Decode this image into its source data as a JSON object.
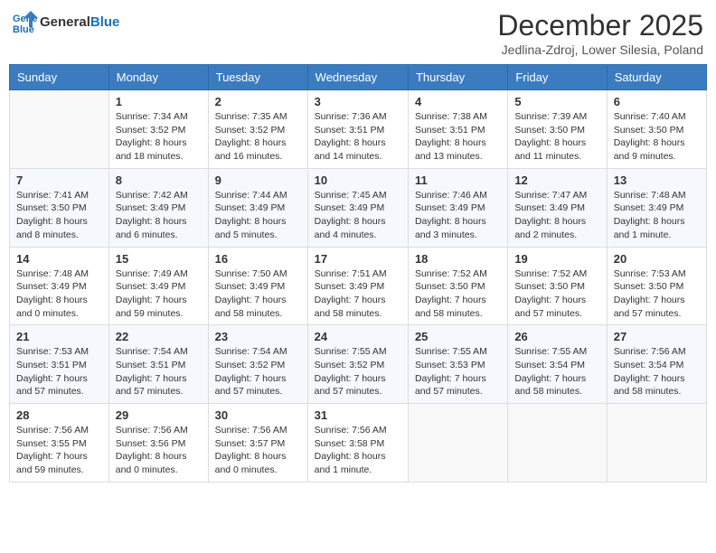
{
  "header": {
    "logo_line1": "General",
    "logo_line2": "Blue",
    "month": "December 2025",
    "location": "Jedlina-Zdroj, Lower Silesia, Poland"
  },
  "weekdays": [
    "Sunday",
    "Monday",
    "Tuesday",
    "Wednesday",
    "Thursday",
    "Friday",
    "Saturday"
  ],
  "weeks": [
    [
      {
        "day": "",
        "sunrise": "",
        "sunset": "",
        "daylight": ""
      },
      {
        "day": "1",
        "sunrise": "Sunrise: 7:34 AM",
        "sunset": "Sunset: 3:52 PM",
        "daylight": "Daylight: 8 hours and 18 minutes."
      },
      {
        "day": "2",
        "sunrise": "Sunrise: 7:35 AM",
        "sunset": "Sunset: 3:52 PM",
        "daylight": "Daylight: 8 hours and 16 minutes."
      },
      {
        "day": "3",
        "sunrise": "Sunrise: 7:36 AM",
        "sunset": "Sunset: 3:51 PM",
        "daylight": "Daylight: 8 hours and 14 minutes."
      },
      {
        "day": "4",
        "sunrise": "Sunrise: 7:38 AM",
        "sunset": "Sunset: 3:51 PM",
        "daylight": "Daylight: 8 hours and 13 minutes."
      },
      {
        "day": "5",
        "sunrise": "Sunrise: 7:39 AM",
        "sunset": "Sunset: 3:50 PM",
        "daylight": "Daylight: 8 hours and 11 minutes."
      },
      {
        "day": "6",
        "sunrise": "Sunrise: 7:40 AM",
        "sunset": "Sunset: 3:50 PM",
        "daylight": "Daylight: 8 hours and 9 minutes."
      }
    ],
    [
      {
        "day": "7",
        "sunrise": "Sunrise: 7:41 AM",
        "sunset": "Sunset: 3:50 PM",
        "daylight": "Daylight: 8 hours and 8 minutes."
      },
      {
        "day": "8",
        "sunrise": "Sunrise: 7:42 AM",
        "sunset": "Sunset: 3:49 PM",
        "daylight": "Daylight: 8 hours and 6 minutes."
      },
      {
        "day": "9",
        "sunrise": "Sunrise: 7:44 AM",
        "sunset": "Sunset: 3:49 PM",
        "daylight": "Daylight: 8 hours and 5 minutes."
      },
      {
        "day": "10",
        "sunrise": "Sunrise: 7:45 AM",
        "sunset": "Sunset: 3:49 PM",
        "daylight": "Daylight: 8 hours and 4 minutes."
      },
      {
        "day": "11",
        "sunrise": "Sunrise: 7:46 AM",
        "sunset": "Sunset: 3:49 PM",
        "daylight": "Daylight: 8 hours and 3 minutes."
      },
      {
        "day": "12",
        "sunrise": "Sunrise: 7:47 AM",
        "sunset": "Sunset: 3:49 PM",
        "daylight": "Daylight: 8 hours and 2 minutes."
      },
      {
        "day": "13",
        "sunrise": "Sunrise: 7:48 AM",
        "sunset": "Sunset: 3:49 PM",
        "daylight": "Daylight: 8 hours and 1 minute."
      }
    ],
    [
      {
        "day": "14",
        "sunrise": "Sunrise: 7:48 AM",
        "sunset": "Sunset: 3:49 PM",
        "daylight": "Daylight: 8 hours and 0 minutes."
      },
      {
        "day": "15",
        "sunrise": "Sunrise: 7:49 AM",
        "sunset": "Sunset: 3:49 PM",
        "daylight": "Daylight: 7 hours and 59 minutes."
      },
      {
        "day": "16",
        "sunrise": "Sunrise: 7:50 AM",
        "sunset": "Sunset: 3:49 PM",
        "daylight": "Daylight: 7 hours and 58 minutes."
      },
      {
        "day": "17",
        "sunrise": "Sunrise: 7:51 AM",
        "sunset": "Sunset: 3:49 PM",
        "daylight": "Daylight: 7 hours and 58 minutes."
      },
      {
        "day": "18",
        "sunrise": "Sunrise: 7:52 AM",
        "sunset": "Sunset: 3:50 PM",
        "daylight": "Daylight: 7 hours and 58 minutes."
      },
      {
        "day": "19",
        "sunrise": "Sunrise: 7:52 AM",
        "sunset": "Sunset: 3:50 PM",
        "daylight": "Daylight: 7 hours and 57 minutes."
      },
      {
        "day": "20",
        "sunrise": "Sunrise: 7:53 AM",
        "sunset": "Sunset: 3:50 PM",
        "daylight": "Daylight: 7 hours and 57 minutes."
      }
    ],
    [
      {
        "day": "21",
        "sunrise": "Sunrise: 7:53 AM",
        "sunset": "Sunset: 3:51 PM",
        "daylight": "Daylight: 7 hours and 57 minutes."
      },
      {
        "day": "22",
        "sunrise": "Sunrise: 7:54 AM",
        "sunset": "Sunset: 3:51 PM",
        "daylight": "Daylight: 7 hours and 57 minutes."
      },
      {
        "day": "23",
        "sunrise": "Sunrise: 7:54 AM",
        "sunset": "Sunset: 3:52 PM",
        "daylight": "Daylight: 7 hours and 57 minutes."
      },
      {
        "day": "24",
        "sunrise": "Sunrise: 7:55 AM",
        "sunset": "Sunset: 3:52 PM",
        "daylight": "Daylight: 7 hours and 57 minutes."
      },
      {
        "day": "25",
        "sunrise": "Sunrise: 7:55 AM",
        "sunset": "Sunset: 3:53 PM",
        "daylight": "Daylight: 7 hours and 57 minutes."
      },
      {
        "day": "26",
        "sunrise": "Sunrise: 7:55 AM",
        "sunset": "Sunset: 3:54 PM",
        "daylight": "Daylight: 7 hours and 58 minutes."
      },
      {
        "day": "27",
        "sunrise": "Sunrise: 7:56 AM",
        "sunset": "Sunset: 3:54 PM",
        "daylight": "Daylight: 7 hours and 58 minutes."
      }
    ],
    [
      {
        "day": "28",
        "sunrise": "Sunrise: 7:56 AM",
        "sunset": "Sunset: 3:55 PM",
        "daylight": "Daylight: 7 hours and 59 minutes."
      },
      {
        "day": "29",
        "sunrise": "Sunrise: 7:56 AM",
        "sunset": "Sunset: 3:56 PM",
        "daylight": "Daylight: 8 hours and 0 minutes."
      },
      {
        "day": "30",
        "sunrise": "Sunrise: 7:56 AM",
        "sunset": "Sunset: 3:57 PM",
        "daylight": "Daylight: 8 hours and 0 minutes."
      },
      {
        "day": "31",
        "sunrise": "Sunrise: 7:56 AM",
        "sunset": "Sunset: 3:58 PM",
        "daylight": "Daylight: 8 hours and 1 minute."
      },
      {
        "day": "",
        "sunrise": "",
        "sunset": "",
        "daylight": ""
      },
      {
        "day": "",
        "sunrise": "",
        "sunset": "",
        "daylight": ""
      },
      {
        "day": "",
        "sunrise": "",
        "sunset": "",
        "daylight": ""
      }
    ]
  ]
}
